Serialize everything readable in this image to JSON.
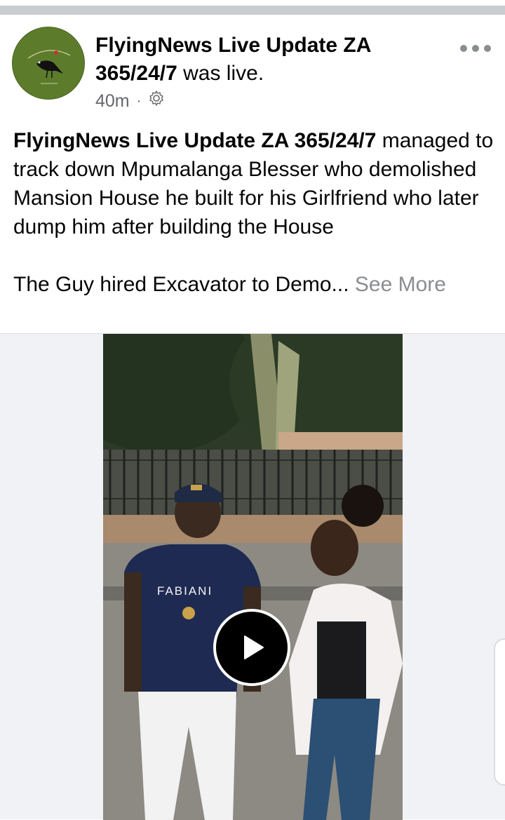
{
  "post": {
    "author_name": "FlyingNews Live Update ZA 365/24/7",
    "author_suffix": " was live.",
    "time": "40m",
    "separator": "·",
    "privacy_icon": "gear-icon",
    "more_icon": "more-horizontal-icon",
    "body_lead": "FlyingNews Live Update ZA 365/24/7",
    "body_text": " managed to track down Mpumalanga Blesser who demolished Mansion House he built for his Girlfriend who later dump him after building the House",
    "body_second": "The Guy hired Excavator to Demo...",
    "see_more": " See More"
  },
  "video": {
    "play_icon": "play-icon",
    "shirt_text": "FABIANI"
  },
  "colors": {
    "divider": "#c9ccd1",
    "secondary_text": "#65676b",
    "see_more": "#8a8d91",
    "avatar_bg": "#5a7a2b",
    "background": "#ffffff"
  }
}
